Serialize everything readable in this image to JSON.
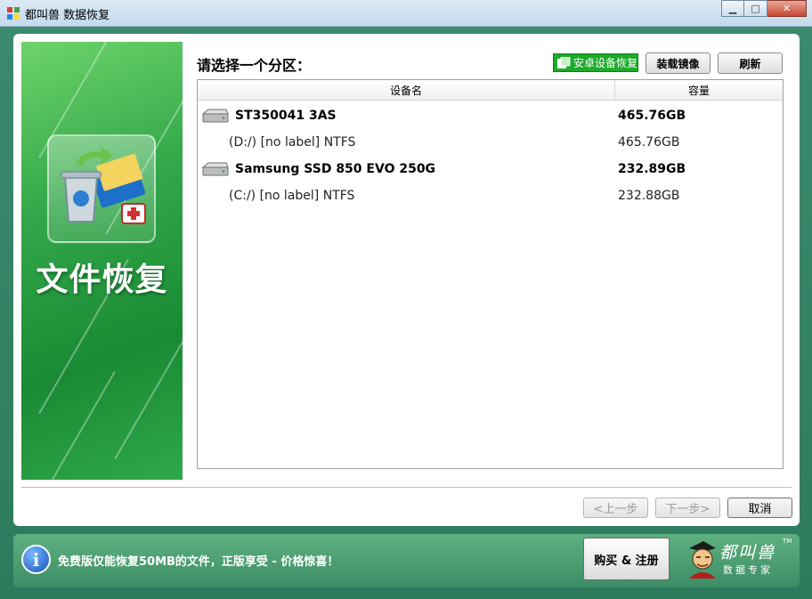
{
  "window": {
    "title": "都叫兽 数据恢复",
    "minimize_glyph": "▁",
    "maximize_glyph": "□",
    "close_glyph": "✕"
  },
  "banner": {
    "title": "文件恢复",
    "icon": "recycle-bin-folder-icon"
  },
  "main": {
    "prompt": "请选择一个分区：",
    "android_button": "安卓设备恢复",
    "mount_image_button": "装载镜像",
    "refresh_button": "刷新",
    "table": {
      "columns": [
        "设备名",
        "容量"
      ],
      "rows": [
        {
          "kind": "disk",
          "name": "ST350041 3AS",
          "capacity": "465.76GB"
        },
        {
          "kind": "partition",
          "name": "(D:/) [no label] NTFS",
          "capacity": "465.76GB"
        },
        {
          "kind": "disk",
          "name": "Samsung SSD 850 EVO 250G",
          "capacity": "232.89GB"
        },
        {
          "kind": "partition",
          "name": "(C:/) [no label] NTFS",
          "capacity": "232.88GB"
        }
      ]
    }
  },
  "nav": {
    "prev": "<上一步",
    "next": "下一步>",
    "cancel": "取消"
  },
  "bottom": {
    "info_glyph": "i",
    "promo": "免费版仅能恢复50MB的文件，正版享受 - 价格惊喜！",
    "buy_button": "购买 & 注册",
    "logo_line1": "都叫兽",
    "logo_line2": "数据专家",
    "logo_tm": "TM"
  },
  "colors": {
    "accent_green": "#1eaa2b",
    "banner_green": "#33a84a",
    "bottom_bar": "#3c8d66"
  }
}
